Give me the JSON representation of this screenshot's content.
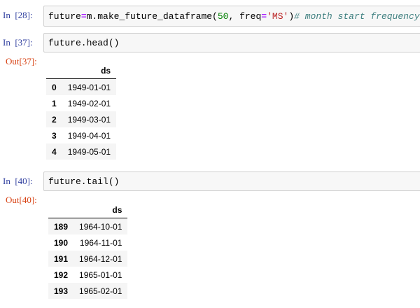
{
  "cells": [
    {
      "in_prompt": "In  [28]:",
      "code": {
        "var": "future",
        "eq": "=",
        "call": "m.make_future_dataframe(",
        "num": "50",
        "mid": ", freq",
        "eq2": "=",
        "str": "'MS'",
        "close": ")",
        "comment": "# month start frequency"
      }
    },
    {
      "in_prompt": "In  [37]:",
      "code": "future.head()",
      "out_prompt": "Out[37]:",
      "table": {
        "header": [
          "",
          "ds"
        ],
        "rows": [
          [
            "0",
            "1949-01-01"
          ],
          [
            "1",
            "1949-02-01"
          ],
          [
            "2",
            "1949-03-01"
          ],
          [
            "3",
            "1949-04-01"
          ],
          [
            "4",
            "1949-05-01"
          ]
        ]
      }
    },
    {
      "in_prompt": "In  [40]:",
      "code": "future.tail()",
      "out_prompt": "Out[40]:",
      "table": {
        "header": [
          "",
          "ds"
        ],
        "rows": [
          [
            "189",
            "1964-10-01"
          ],
          [
            "190",
            "1964-11-01"
          ],
          [
            "191",
            "1964-12-01"
          ],
          [
            "192",
            "1965-01-01"
          ],
          [
            "193",
            "1965-02-01"
          ]
        ]
      }
    }
  ]
}
